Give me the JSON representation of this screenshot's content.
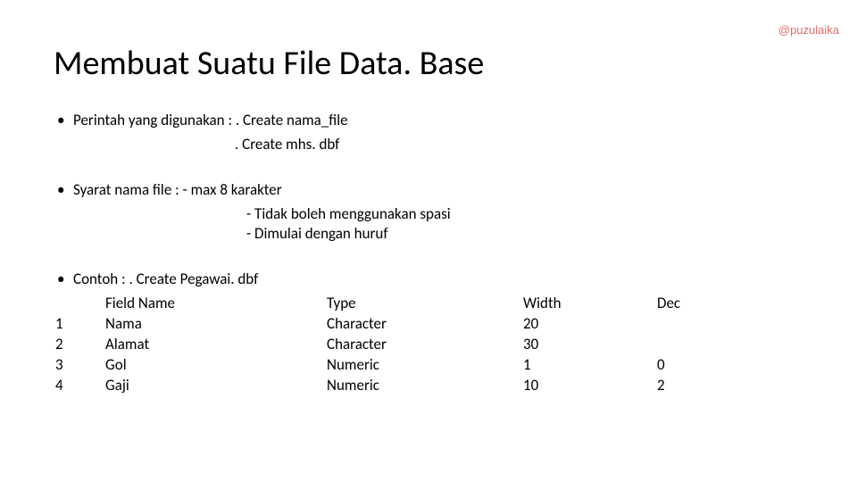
{
  "watermark": "@puzulaika",
  "title": "Membuat Suatu File Data. Base",
  "block1": {
    "line1": "Perintah yang digunakan :  . Create nama_file",
    "line2": ". Create mhs. dbf"
  },
  "block2": {
    "line1": "Syarat nama file : - max 8 karakter",
    "line2": "- Tidak boleh menggunakan spasi",
    "line3": "- Dimulai dengan huruf"
  },
  "block3": {
    "line1": "Contoh : . Create Pegawai. dbf",
    "header": {
      "field": "Field Name",
      "type": "Type",
      "width": "Width",
      "dec": "Dec"
    },
    "rows": [
      {
        "n": "1",
        "field": "Nama",
        "type": "Character",
        "width": "20",
        "dec": ""
      },
      {
        "n": "2",
        "field": "Alamat",
        "type": "Character",
        "width": "30",
        "dec": ""
      },
      {
        "n": "3",
        "field": "Gol",
        "type": "Numeric",
        "width": "1",
        "dec": "0"
      },
      {
        "n": "4",
        "field": "Gaji",
        "type": "Numeric",
        "width": "10",
        "dec": "2"
      }
    ]
  }
}
